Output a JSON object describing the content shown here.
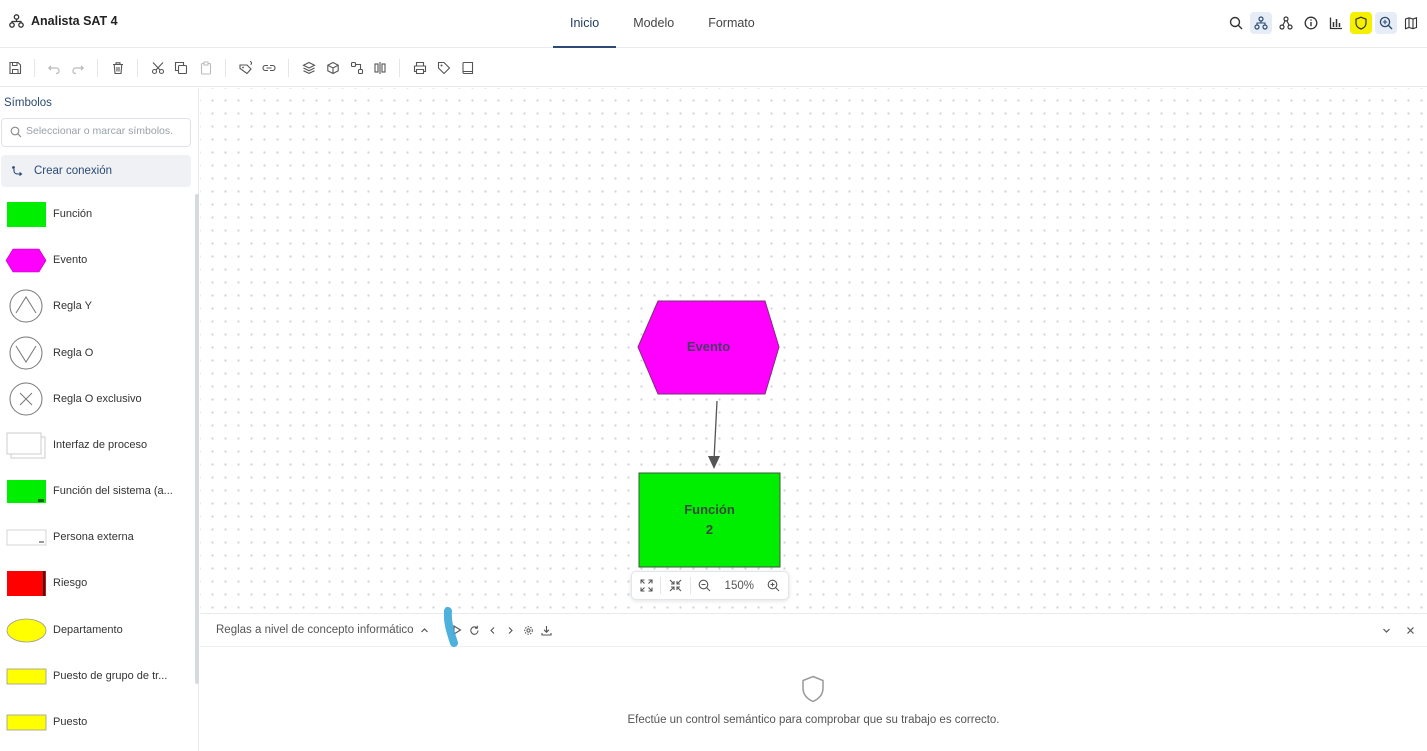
{
  "header": {
    "app_title": "Analista SAT 4",
    "tabs": [
      {
        "label": "Inicio",
        "active": true
      },
      {
        "label": "Modelo",
        "active": false
      },
      {
        "label": "Formato",
        "active": false
      }
    ],
    "icons": [
      "search-icon",
      "model-tree-icon",
      "hierarchy-icon",
      "info-icon",
      "chart-icon",
      "shield-icon",
      "zoom-search-icon",
      "map-icon"
    ],
    "highlight_color": "#f5f000"
  },
  "toolbar": {
    "icons": [
      "save-icon",
      "undo-icon",
      "redo-icon",
      "delete-icon",
      "cut-icon",
      "copy-icon",
      "paste-icon",
      "format-painter-icon",
      "link-icon",
      "layers-icon",
      "cube-icon",
      "connector-icon",
      "align-icon",
      "print-icon",
      "tag-icon",
      "book-icon"
    ]
  },
  "sidebar": {
    "title": "Símbolos",
    "search_placeholder": "Seleccionar o marcar símbolos.",
    "create_connection": "Crear conexión",
    "items": [
      {
        "label": "Función",
        "shape": "rect",
        "color": "#00ee00"
      },
      {
        "label": "Evento",
        "shape": "hexagon",
        "color": "#ff00ff"
      },
      {
        "label": "Regla Y",
        "shape": "rule-and",
        "color": "#ffffff"
      },
      {
        "label": "Regla O",
        "shape": "rule-or",
        "color": "#ffffff"
      },
      {
        "label": "Regla O exclusivo",
        "shape": "rule-xor",
        "color": "#ffffff"
      },
      {
        "label": "Interfaz de proceso",
        "shape": "interface",
        "color": "#ffffff"
      },
      {
        "label": "Función del sistema (a...",
        "shape": "rect",
        "color": "#00ee00"
      },
      {
        "label": "Persona externa",
        "shape": "rect-outline",
        "color": "#ffffff"
      },
      {
        "label": "Riesgo",
        "shape": "rect",
        "color": "#ff0000"
      },
      {
        "label": "Departamento",
        "shape": "ellipse",
        "color": "#ffff00"
      },
      {
        "label": "Puesto de grupo de tr...",
        "shape": "rect",
        "color": "#ffff00"
      },
      {
        "label": "Puesto",
        "shape": "rect",
        "color": "#ffff00"
      }
    ]
  },
  "canvas": {
    "event_shape": {
      "label": "Evento",
      "color": "#ff00ff"
    },
    "function_shape": {
      "label_line1": "Función",
      "label_line2": "2",
      "color": "#00ee00"
    },
    "zoom": "150%"
  },
  "bottom_panel": {
    "title": "Reglas a nivel de concepto informático",
    "empty_message": "Efectúe un control semántico para comprobar que su trabajo es correcto.",
    "marker_color": "#3aa8d8"
  }
}
